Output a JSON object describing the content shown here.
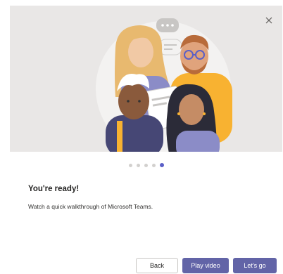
{
  "dialog": {
    "title": "You're ready!",
    "subtitle": "Watch a quick walkthrough of Microsoft Teams.",
    "close_icon": "close-icon"
  },
  "carousel": {
    "total": 5,
    "active_index": 4
  },
  "buttons": {
    "back": "Back",
    "play_video": "Play video",
    "lets_go": "Let's go"
  },
  "colors": {
    "accent": "#6264a7",
    "hero_bg": "#e9e7e6"
  }
}
